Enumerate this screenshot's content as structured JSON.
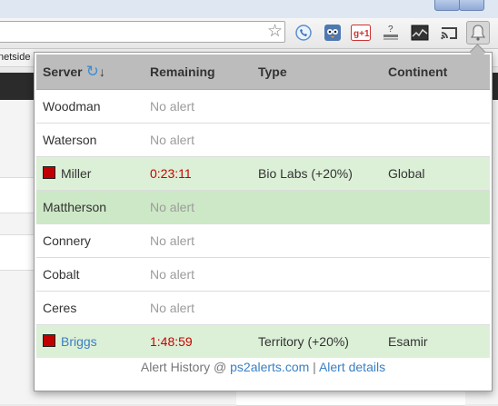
{
  "bookmarks": [
    "netside"
  ],
  "extensions": [
    {
      "name": "phone-extension-icon"
    },
    {
      "name": "owl-extension-icon"
    },
    {
      "name": "google-plus-one-icon",
      "label": "+1"
    },
    {
      "name": "help-extension-icon",
      "label": "?"
    },
    {
      "name": "chart-extension-icon"
    },
    {
      "name": "cast-icon"
    },
    {
      "name": "alerts-bell-icon"
    }
  ],
  "table": {
    "headers": {
      "server": "Server",
      "sort_arrow": "↓",
      "remaining": "Remaining",
      "type": "Type",
      "continent": "Continent"
    },
    "rows": [
      {
        "server": "Woodman",
        "remaining": "No alert",
        "type": "",
        "continent": ""
      },
      {
        "server": "Waterson",
        "remaining": "No alert",
        "type": "",
        "continent": ""
      },
      {
        "server": "Miller",
        "remaining": "0:23:11",
        "type": "Bio Labs (+20%)",
        "continent": "Global"
      },
      {
        "server": "Mattherson",
        "remaining": "No alert",
        "type": "",
        "continent": ""
      },
      {
        "server": "Connery",
        "remaining": "No alert",
        "type": "",
        "continent": ""
      },
      {
        "server": "Cobalt",
        "remaining": "No alert",
        "type": "",
        "continent": ""
      },
      {
        "server": "Ceres",
        "remaining": "No alert",
        "type": "",
        "continent": ""
      },
      {
        "server": "Briggs",
        "remaining": "1:48:59",
        "type": "Territory (+20%)",
        "continent": "Esamir"
      }
    ]
  },
  "footer": {
    "prefix": "Alert History @",
    "link1": "ps2alerts.com",
    "separator": "|",
    "link2": "Alert details"
  },
  "colors": {
    "active_row": "#dcf0d7",
    "selected_row": "#cde8c6",
    "timer": "#cc0000",
    "link": "#3b7fc4",
    "header_bg": "#bcbcbc"
  }
}
